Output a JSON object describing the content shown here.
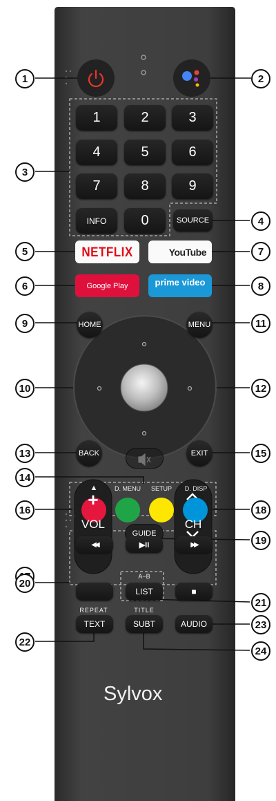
{
  "colors": {
    "body": "#3b3b3b",
    "button": "#1c1c1c",
    "power_red": "#e8362b",
    "netflix_red": "#e50914",
    "youtube_red": "#ff0000",
    "google_play_red": "#e0103c",
    "prime_blue": "#1a98d8",
    "red": "#e5173f",
    "green": "#20a448",
    "yellow": "#fde600",
    "blue": "#0095da"
  },
  "callouts": [
    "1",
    "2",
    "3",
    "4",
    "5",
    "6",
    "7",
    "8",
    "9",
    "10",
    "11",
    "12",
    "13",
    "14",
    "15",
    "16",
    "17",
    "18",
    "19",
    "20",
    "21",
    "22",
    "23",
    "24"
  ],
  "keypad": {
    "digits": [
      "1",
      "2",
      "3",
      "4",
      "5",
      "6",
      "7",
      "8",
      "9",
      "0"
    ],
    "info": "INFO",
    "source": "SOURCE"
  },
  "apps": {
    "netflix": "NETFLIX",
    "youtube": "YouTube",
    "google_play": "Google Play",
    "prime": "prime video"
  },
  "nav": {
    "home": "HOME",
    "menu": "MENU",
    "back": "BACK",
    "exit": "EXIT"
  },
  "volume": {
    "plus": "+",
    "label": "VOL",
    "minus": "−"
  },
  "channel": {
    "label": "CH"
  },
  "guide": "GUIDE",
  "color_captions": [
    "▲",
    "D. MENU",
    "SETUP",
    "D. DISP"
  ],
  "media": {
    "rew": "◀◀",
    "play_pause": "▶II",
    "ffwd": "▶▶",
    "ab": "A−B",
    "list": "LIST",
    "stop": "■"
  },
  "bottom": {
    "repeat": "REPEAT",
    "text": "TEXT",
    "title": "TITLE",
    "subt": "SUBT",
    "audio": "AUDIO"
  },
  "brand": "Sylvox",
  "icons": [
    "power-icon",
    "assistant-icon",
    "mute-icon",
    "chevron-up-icon",
    "chevron-down-icon",
    "record-icon"
  ]
}
